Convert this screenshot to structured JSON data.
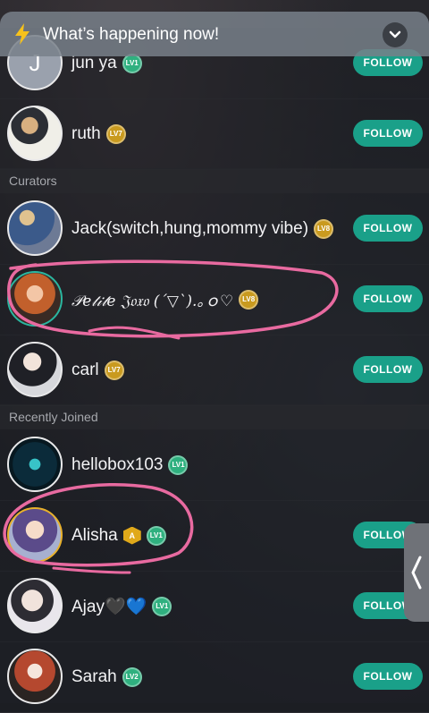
{
  "banner": {
    "title": "What’s happening now!",
    "icon": "lightning-icon",
    "toggle_icon": "chevron-down-icon"
  },
  "sections": {
    "curators": "Curators",
    "recently_joined": "Recently Joined"
  },
  "follow_label": "FOLLOW",
  "users": [
    {
      "name": "jun ya",
      "level": "LV1",
      "level_color": "#2fb07f"
    },
    {
      "name": "ruth",
      "level": "LV7",
      "level_color": "#c99a1f"
    },
    {
      "name": "Jack(switch,hung,mommy vibe)",
      "level": "LV8",
      "level_color": "#c99a1f"
    },
    {
      "name": "𝒫𝑒𝓉𝒾𝓉𝑒 𝔍𝔬𝔵𝔬 (´▽`).｡ｏ♡",
      "level": "LV8",
      "level_color": "#c99a1f"
    },
    {
      "name": "carl",
      "level": "LV7",
      "level_color": "#c99a1f"
    },
    {
      "name": "hellobox103",
      "level": "LV1",
      "level_color": "#2fb07f"
    },
    {
      "name": "Alisha",
      "badge": "A",
      "level": "LV1",
      "level_color": "#2fb07f"
    },
    {
      "name": "Ajay🖤💙",
      "level": "LV1",
      "level_color": "#2fb07f"
    },
    {
      "name": "Sarah",
      "level": "LV2",
      "level_color": "#2fb07f"
    }
  ],
  "colors": {
    "follow": "#1aa089",
    "annotation": "#e86aa0",
    "banner": "#78808a"
  }
}
